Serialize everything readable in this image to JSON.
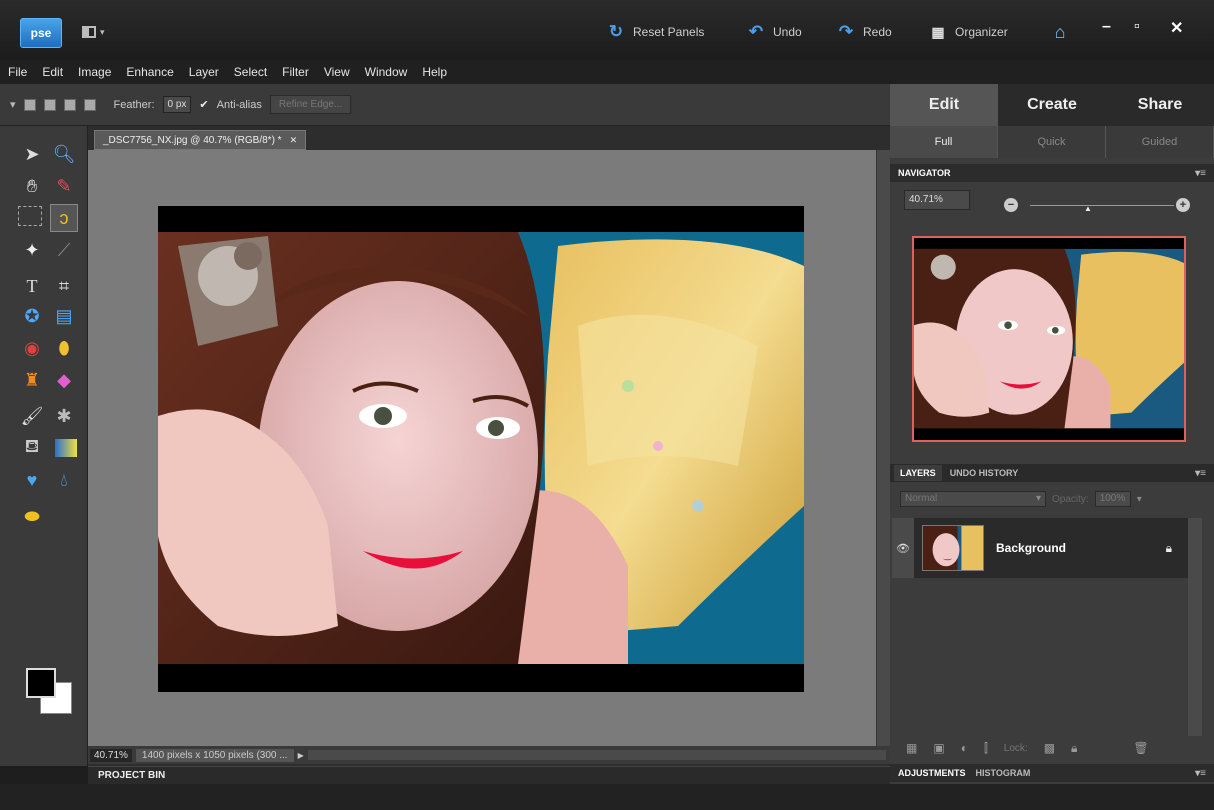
{
  "titlebar": {
    "logo_text": "pse",
    "reset_panels": "Reset Panels",
    "undo": "Undo",
    "redo": "Redo",
    "organizer": "Organizer",
    "icons": {
      "reset": "circular-arrow-icon",
      "undo": "undo-arrow-icon",
      "redo": "redo-arrow-icon",
      "organizer": "calendar-grid-icon",
      "home": "home-icon"
    },
    "window_controls": {
      "minimize": "–",
      "restore": "▫",
      "close": "✕"
    }
  },
  "menu": [
    "File",
    "Edit",
    "Image",
    "Enhance",
    "Layer",
    "Select",
    "Filter",
    "View",
    "Window",
    "Help"
  ],
  "options": {
    "feather_label": "Feather:",
    "feather_value": "0 px",
    "anti_alias": "Anti-alias",
    "refine_edge": "Refine Edge..."
  },
  "document": {
    "tab_title": "_DSC7756_NX.jpg @ 40.7% (RGB/8*) *",
    "zoom": "40.71%",
    "info": "1400 pixels x 1050 pixels (300 ..."
  },
  "project_bin": "PROJECT BIN",
  "right_panel": {
    "tabs": [
      "Edit",
      "Create",
      "Share"
    ],
    "active_tab": "Edit",
    "subtabs": [
      "Full",
      "Quick",
      "Guided"
    ],
    "active_subtab": "Full",
    "navigator": {
      "title": "NAVIGATOR",
      "zoom": "40.71%"
    },
    "layers_tab": "LAYERS",
    "undo_history_tab": "UNDO HISTORY",
    "blend_mode": "Normal",
    "opacity_label": "Opacity:",
    "opacity_value": "100%",
    "layer_name": "Background",
    "lock_label": "Lock:",
    "adjustments_tab": "ADJUSTMENTS",
    "histogram_tab": "HISTOGRAM"
  },
  "colors": {
    "accent": "#4a9eea",
    "navigator_frame": "#e06060",
    "panel_bg": "#3c3c3c",
    "canvas_bg": "#7b7b7b"
  }
}
